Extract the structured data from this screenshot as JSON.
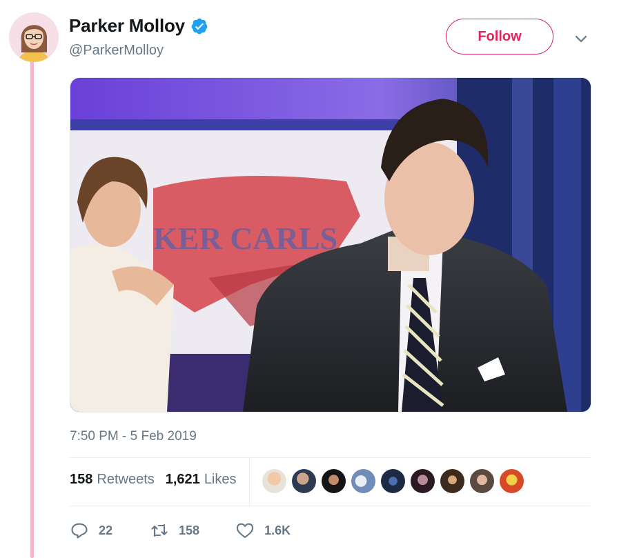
{
  "tweet": {
    "author": {
      "display_name": "Parker Molloy",
      "handle": "@ParkerMolloy",
      "verified": true
    },
    "follow_label": "Follow",
    "media": {
      "background_text": "KER CARLS"
    },
    "timestamp": "7:50 PM - 5 Feb 2019",
    "stats": {
      "retweets_count": "158",
      "retweets_label": "Retweets",
      "likes_count": "1,621",
      "likes_label": "Likes",
      "liker_avatars_shown": 9
    },
    "actions": {
      "reply_count": "22",
      "retweet_count": "158",
      "like_count": "1.6K"
    }
  },
  "colors": {
    "accent": "#e0245e",
    "verified": "#1da1f2",
    "muted": "#657786",
    "thread_line": "#f4b7c9"
  },
  "icons": [
    "verified-badge-icon",
    "chevron-down-icon",
    "reply-icon",
    "retweet-icon",
    "heart-icon"
  ]
}
